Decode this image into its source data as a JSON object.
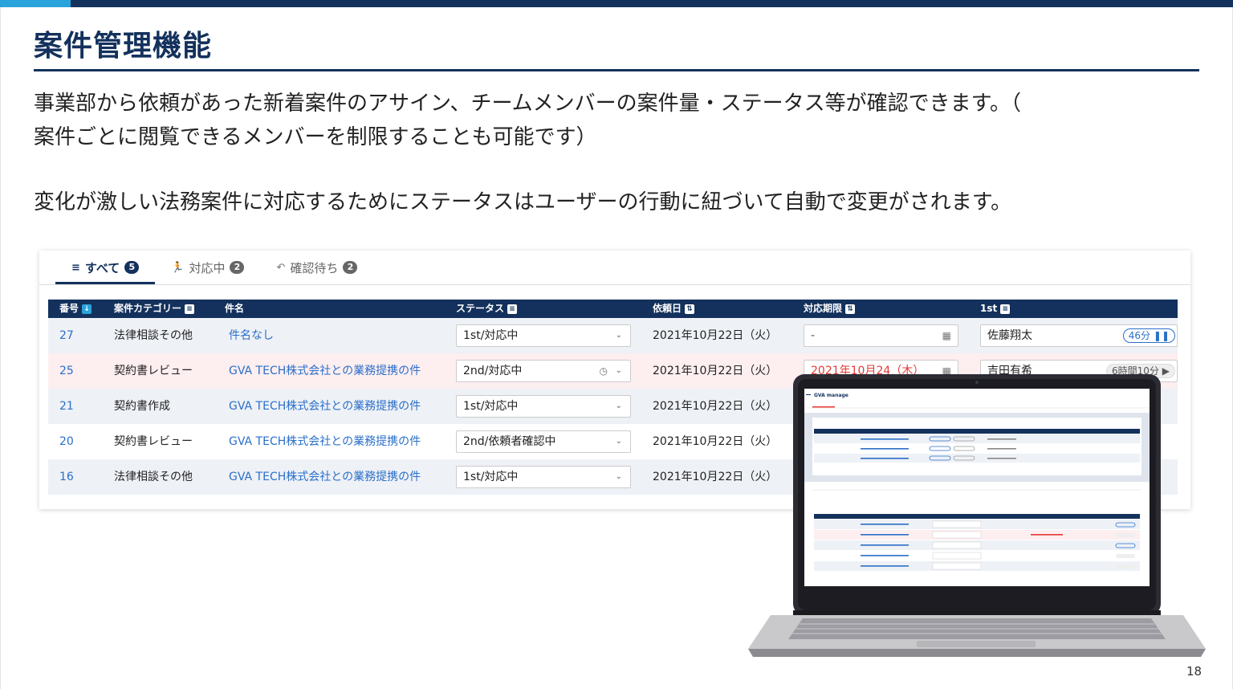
{
  "slide": {
    "title": "案件管理機能",
    "paragraph1_line1": "事業部から依頼があった新着案件のアサイン、チームメンバーの案件量・ステータス等が確認できます。（",
    "paragraph1_line2": "案件ごとに閲覧できるメンバーを制限することも可能です）",
    "paragraph2": "変化が激しい法務案件に対応するためにステータスはユーザーの行動に紐づいて自動で変更がされます。",
    "page_number": "18"
  },
  "tabs": [
    {
      "label": "すべて",
      "count": "5",
      "icon": "list-icon"
    },
    {
      "label": "対応中",
      "count": "2",
      "icon": "running-person-icon"
    },
    {
      "label": "確認待ち",
      "count": "2",
      "icon": "return-arrow-icon"
    }
  ],
  "table": {
    "headers": {
      "number": "番号",
      "category": "案件カテゴリー",
      "title": "件名",
      "status": "ステータス",
      "request_date": "依頼日",
      "deadline": "対応期限",
      "assignee": "1st"
    },
    "rows": [
      {
        "number": "27",
        "category": "法律相談その他",
        "title": "件名なし",
        "status": "1st/対応中",
        "request_date": "2021年10月22日（火）",
        "deadline": "-",
        "assignee": "佐藤翔太",
        "timer": "46分"
      },
      {
        "number": "25",
        "category": "契約書レビュー",
        "title": "GVA TECH株式会社との業務提携の件",
        "status": "2nd/対応中",
        "request_date": "2021年10月22日（火）",
        "deadline": "2021年10月24（木）",
        "assignee": "吉田有希",
        "timer": "6時間10分"
      },
      {
        "number": "21",
        "category": "契約書作成",
        "title": "GVA TECH株式会社との業務提携の件",
        "status": "1st/対応中",
        "request_date": "2021年10月22日（火）",
        "deadline": "",
        "assignee": "",
        "timer": ""
      },
      {
        "number": "20",
        "category": "契約書レビュー",
        "title": "GVA TECH株式会社との業務提携の件",
        "status": "2nd/依頼者確認中",
        "request_date": "2021年10月22日（火）",
        "deadline": "",
        "assignee": "",
        "timer": ""
      },
      {
        "number": "16",
        "category": "法律相談その他",
        "title": "GVA TECH株式会社との業務提携の件",
        "status": "1st/対応中",
        "request_date": "2021年10月22日（火）",
        "deadline": "",
        "assignee": "",
        "timer": ""
      }
    ]
  },
  "laptop_screen": {
    "app_name": "GVA manage"
  },
  "colors": {
    "navy": "#13315c",
    "accent": "#2aa3dc",
    "link": "#2a6fc9",
    "alert_row": "#fdeef0",
    "deadline_red": "#e53935"
  }
}
